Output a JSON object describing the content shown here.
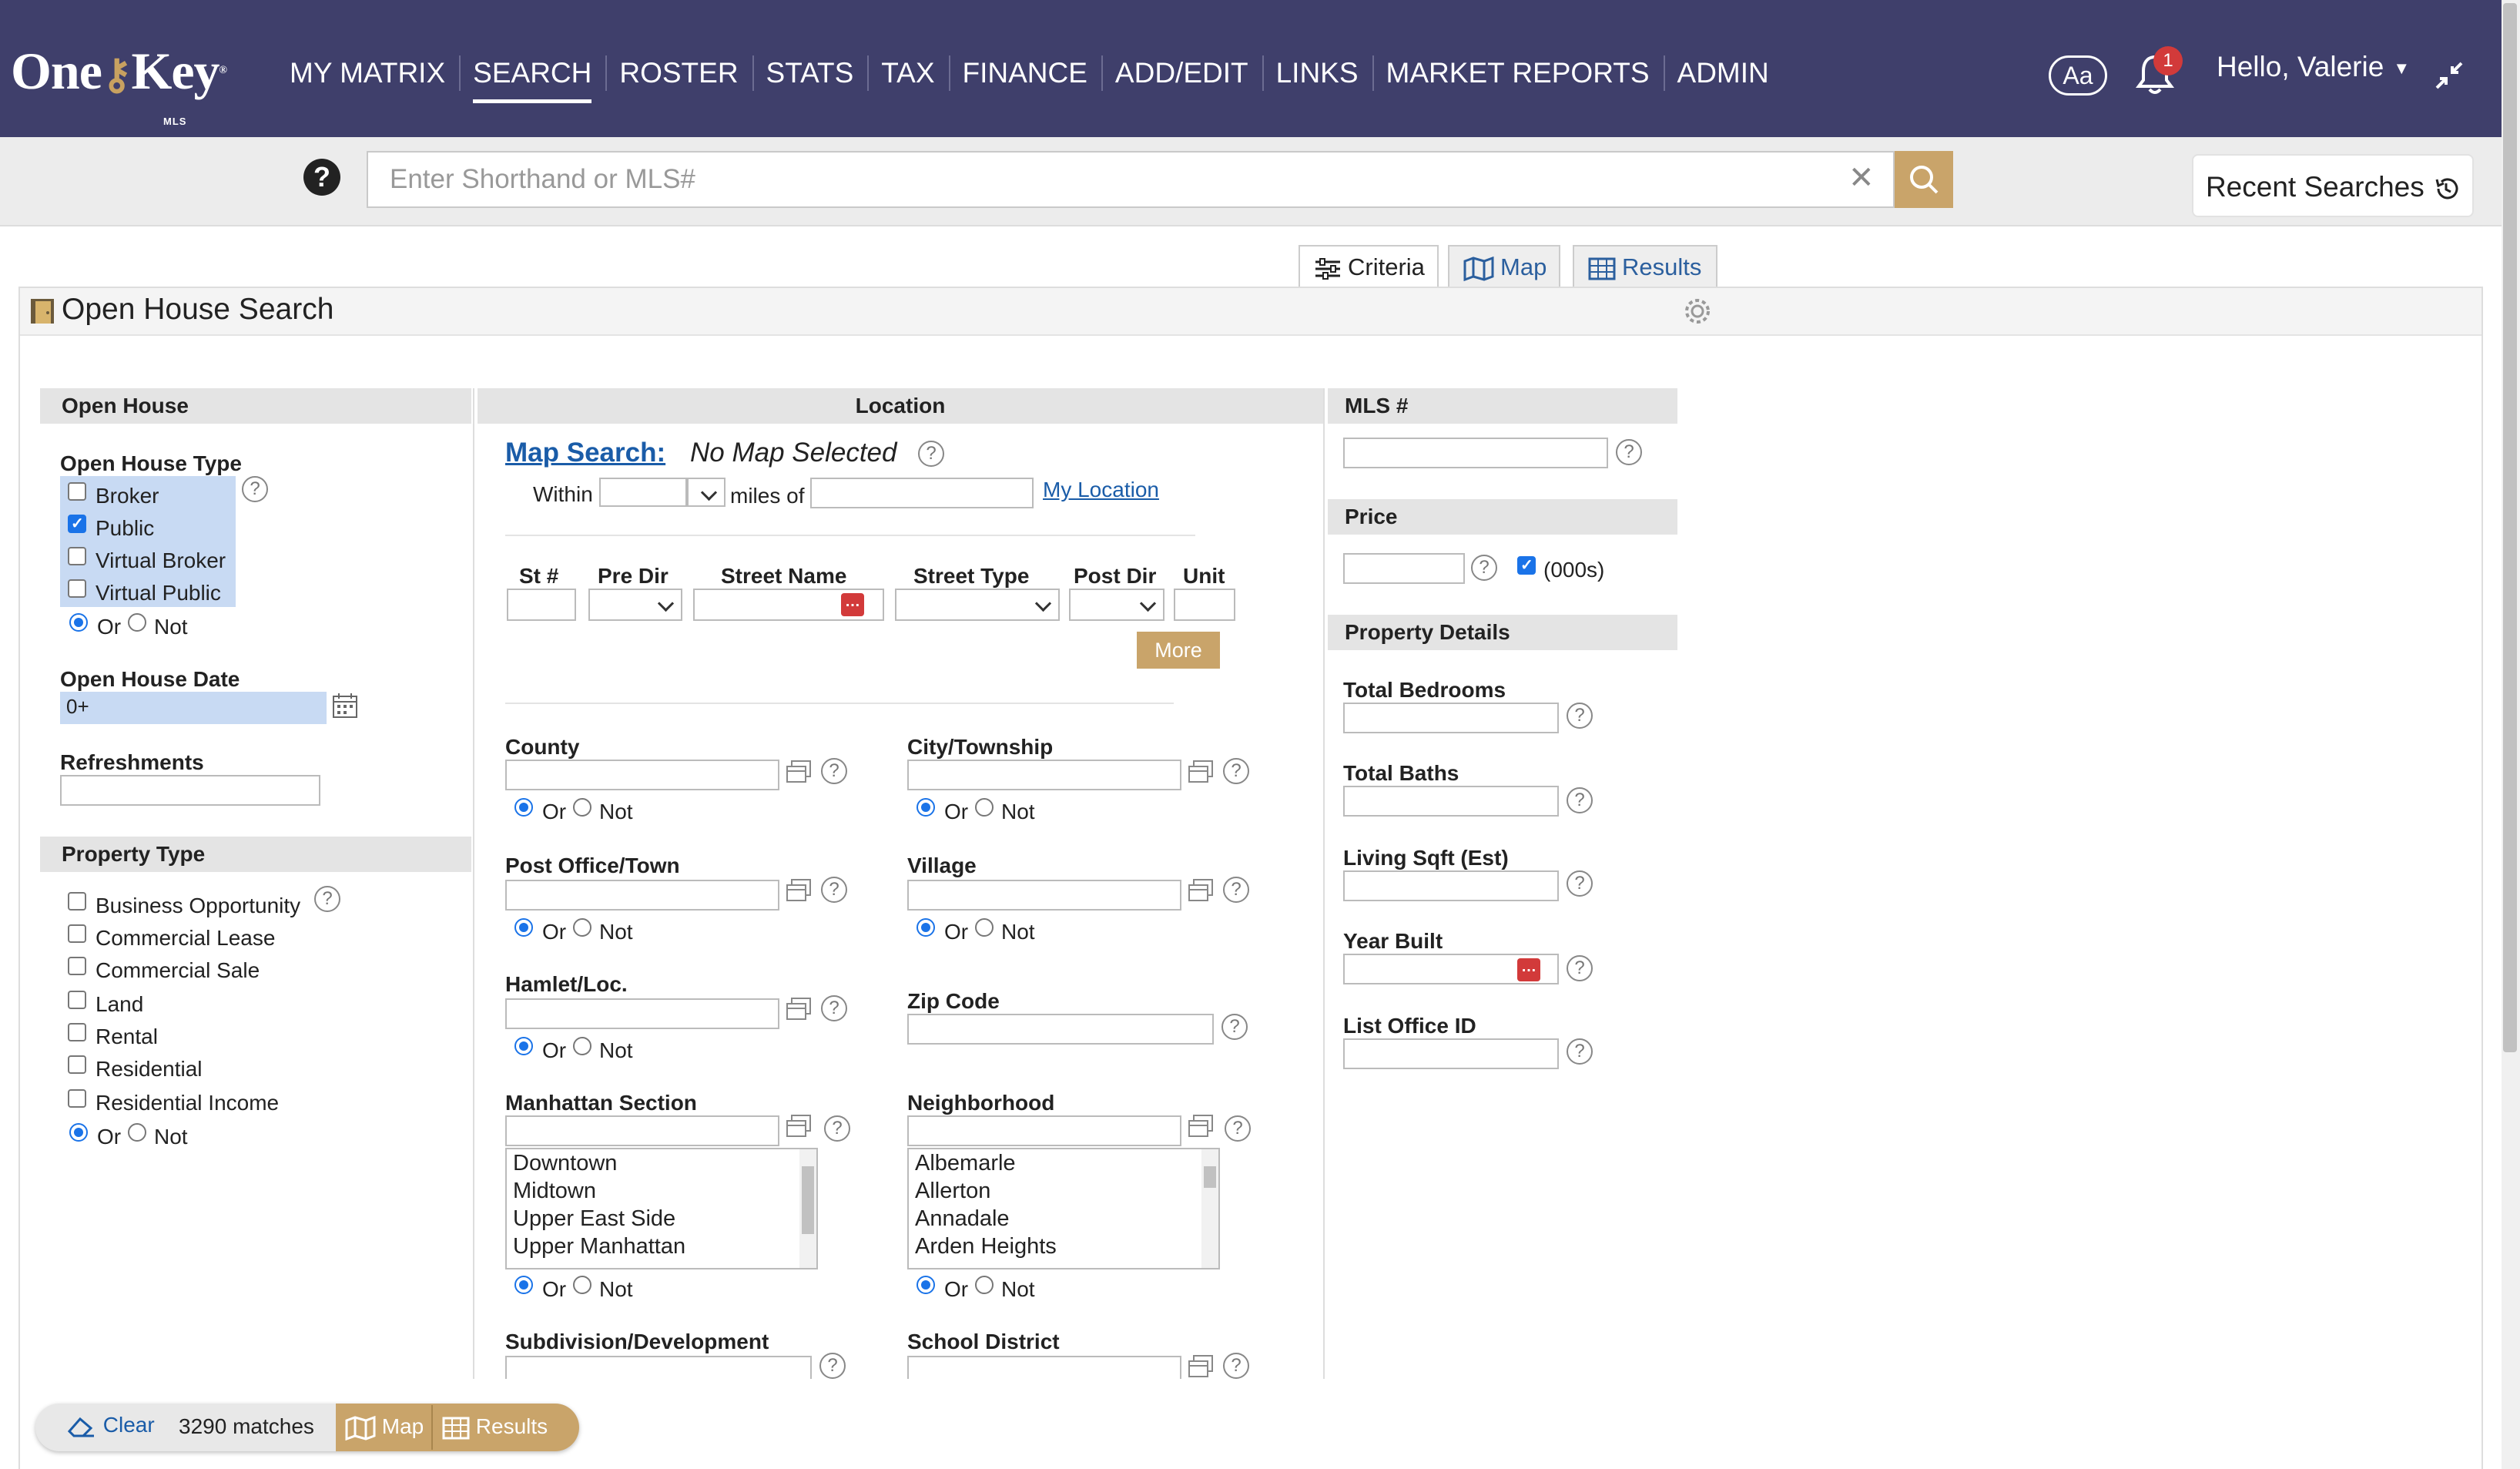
{
  "brand": {
    "logo_one": "One",
    "logo_key": "Key",
    "logo_mls": "MLS",
    "logo_reg": "®"
  },
  "nav": {
    "items": [
      "MY MATRIX",
      "SEARCH",
      "ROSTER",
      "STATS",
      "TAX",
      "FINANCE",
      "ADD/EDIT",
      "LINKS",
      "MARKET REPORTS",
      "ADMIN"
    ],
    "active": "SEARCH"
  },
  "header": {
    "aa_label": "Aa",
    "notification_count": "1",
    "greeting": "Hello, Valerie"
  },
  "search": {
    "placeholder": "Enter Shorthand or MLS#",
    "help": "?",
    "clear": "✕",
    "recent_label": "Recent Searches"
  },
  "tabs": {
    "criteria": "Criteria",
    "map": "Map",
    "results": "Results",
    "active": "Criteria"
  },
  "panel": {
    "title": "Open House Search"
  },
  "open_house": {
    "header": "Open House",
    "type_label": "Open House Type",
    "types": [
      {
        "label": "Broker",
        "checked": false
      },
      {
        "label": "Public",
        "checked": true
      },
      {
        "label": "Virtual Broker",
        "checked": false
      },
      {
        "label": "Virtual Public",
        "checked": false
      }
    ],
    "or_label": "Or",
    "not_label": "Not",
    "date_label": "Open House Date",
    "date_value": "0+",
    "refreshments_label": "Refreshments"
  },
  "property_type": {
    "header": "Property Type",
    "options": [
      {
        "label": "Business Opportunity",
        "checked": false
      },
      {
        "label": "Commercial Lease",
        "checked": false
      },
      {
        "label": "Commercial Sale",
        "checked": false
      },
      {
        "label": "Land",
        "checked": false
      },
      {
        "label": "Rental",
        "checked": false
      },
      {
        "label": "Residential",
        "checked": false
      },
      {
        "label": "Residential Income",
        "checked": false
      }
    ]
  },
  "location": {
    "header": "Location",
    "map_search_label": "Map Search:",
    "map_status": "No Map Selected",
    "within_label": "Within",
    "miles_label": "miles of",
    "my_location": "My Location",
    "address_cols": [
      "St #",
      "Pre Dir",
      "Street Name",
      "Street Type",
      "Post Dir",
      "Unit"
    ],
    "more_label": "More",
    "county": "County",
    "city": "City/Township",
    "post_office": "Post Office/Town",
    "village": "Village",
    "hamlet": "Hamlet/Loc.",
    "zip": "Zip Code",
    "manhattan": "Manhattan Section",
    "manhattan_options": [
      "Downtown",
      "Midtown",
      "Upper East Side",
      "Upper Manhattan"
    ],
    "neighborhood": "Neighborhood",
    "neighborhood_options": [
      "Albemarle",
      "Allerton",
      "Annadale",
      "Arden Heights"
    ],
    "subdivision": "Subdivision/Development",
    "school_district": "School District"
  },
  "mls": {
    "header": "MLS #"
  },
  "price": {
    "header": "Price",
    "thousands_label": "(000s)",
    "thousands_checked": true
  },
  "property_details": {
    "header": "Property Details",
    "fields": [
      "Total Bedrooms",
      "Total Baths",
      "Living Sqft (Est)",
      "Year Built",
      "List Office ID"
    ]
  },
  "bottom_bar": {
    "clear_label": "Clear",
    "matches": "3290 matches",
    "map_label": "Map",
    "results_label": "Results"
  },
  "colors": {
    "nav_bg": "#3f3f6b",
    "accent_gold": "#c9a46a",
    "link_blue": "#1a5ca8",
    "badge_red": "#d23a3a"
  }
}
